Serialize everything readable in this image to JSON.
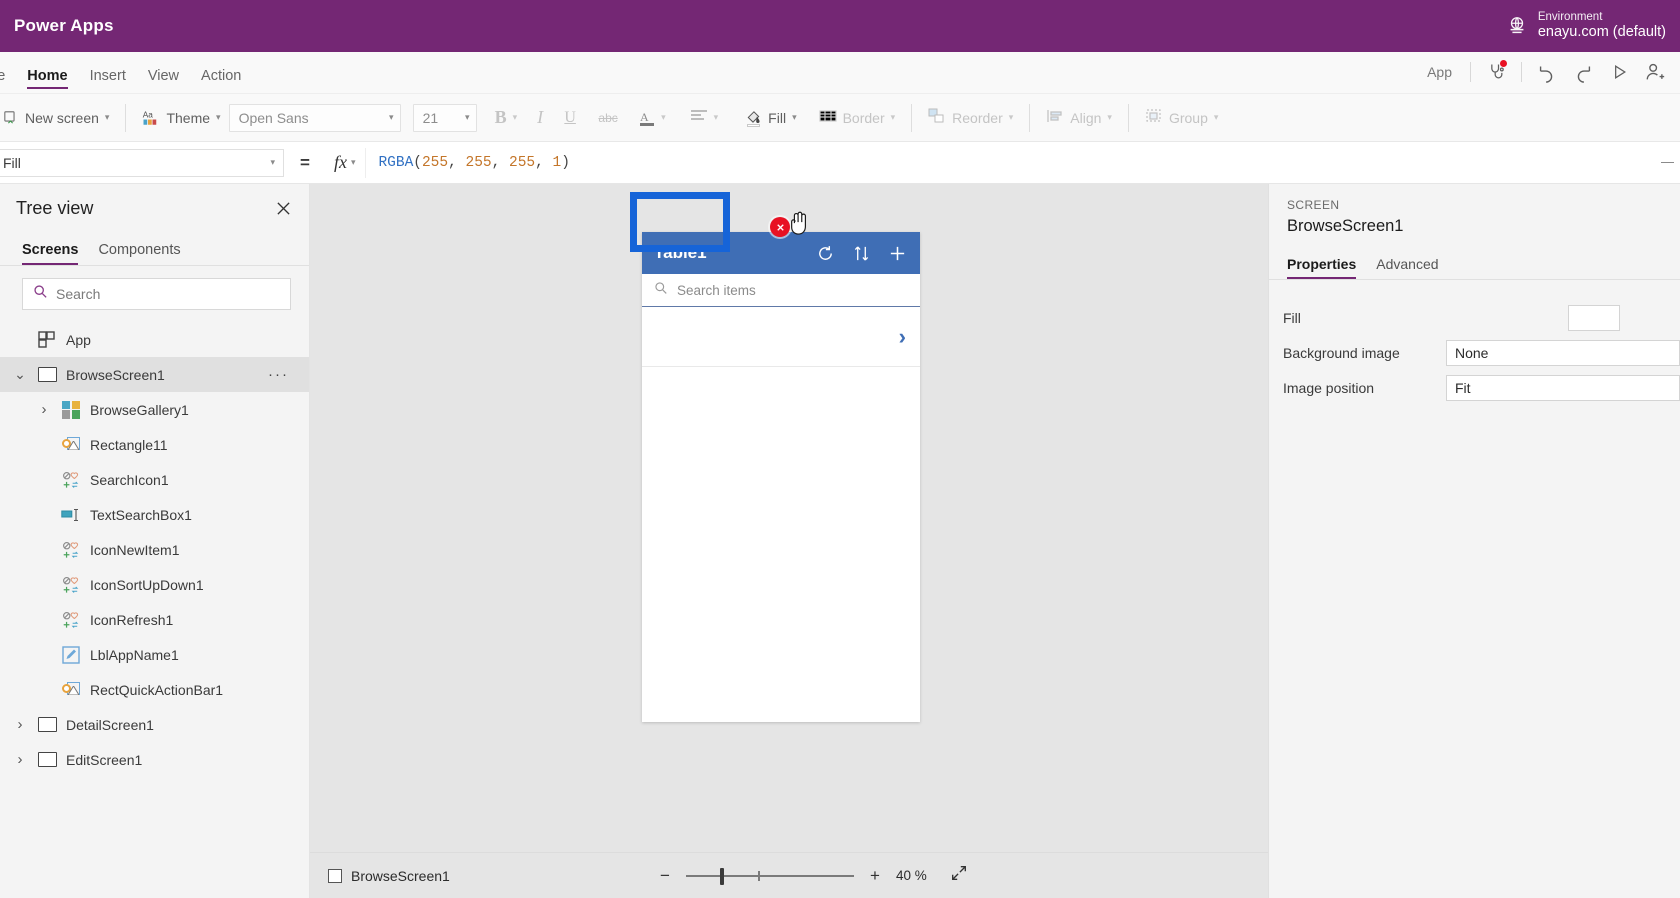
{
  "brand": {
    "title": "Power Apps",
    "globe_icon": "globe-icon",
    "environment_label": "Environment",
    "environment_value": "enayu.com (default)",
    "accent_color": "#742774"
  },
  "menubar": {
    "items": [
      {
        "label": "le",
        "active": false
      },
      {
        "label": "Home",
        "active": true
      },
      {
        "label": "Insert",
        "active": false
      },
      {
        "label": "View",
        "active": false
      },
      {
        "label": "Action",
        "active": false
      }
    ],
    "right": {
      "app_label": "App",
      "checker_icon": "stethoscope-icon",
      "checker_badge_color": "#e81123",
      "undo_icon": "undo-icon",
      "redo_icon": "redo-icon",
      "preview_icon": "play-icon",
      "share_icon": "share-user-icon"
    }
  },
  "ribbon": {
    "new_screen": "New screen",
    "theme": "Theme",
    "font_family": "Open Sans",
    "font_size": "21",
    "bold": "B",
    "italic": "I",
    "underline": "U",
    "strikethrough": "abc",
    "font_color_icon": "font-color-icon",
    "align_icon": "text-align-icon",
    "fill": "Fill",
    "border": "Border",
    "reorder": "Reorder",
    "align": "Align",
    "group": "Group"
  },
  "formula_bar": {
    "property": "Fill",
    "equals": "=",
    "fx": "fx",
    "formula_tokens": [
      {
        "t": "RGBA",
        "k": "fn"
      },
      {
        "t": "(",
        "k": "punct"
      },
      {
        "t": "255",
        "k": "num"
      },
      {
        "t": ", ",
        "k": "punct"
      },
      {
        "t": "255",
        "k": "num"
      },
      {
        "t": ", ",
        "k": "punct"
      },
      {
        "t": "255",
        "k": "num"
      },
      {
        "t": ", ",
        "k": "punct"
      },
      {
        "t": "1",
        "k": "num"
      },
      {
        "t": ")",
        "k": "punct"
      }
    ]
  },
  "treeview": {
    "title": "Tree view",
    "close_icon": "close-icon",
    "tabs": [
      {
        "label": "Screens",
        "active": true
      },
      {
        "label": "Components",
        "active": false
      }
    ],
    "search_placeholder": "Search",
    "search_value": "",
    "items": [
      {
        "label": "App",
        "icon": "app-icon",
        "indent": 0,
        "chevron": "",
        "selected": false,
        "dots": false
      },
      {
        "label": "BrowseScreen1",
        "icon": "screen-icon",
        "indent": 1,
        "chevron": "v",
        "selected": true,
        "dots": true
      },
      {
        "label": "BrowseGallery1",
        "icon": "gallery-icon",
        "indent": 2,
        "chevron": ">",
        "selected": false,
        "dots": false
      },
      {
        "label": "Rectangle11",
        "icon": "shape-icon",
        "indent": 2,
        "chevron": "",
        "selected": false,
        "dots": false
      },
      {
        "label": "SearchIcon1",
        "icon": "icon-control-icon",
        "indent": 2,
        "chevron": "",
        "selected": false,
        "dots": false
      },
      {
        "label": "TextSearchBox1",
        "icon": "textbox-icon",
        "indent": 2,
        "chevron": "",
        "selected": false,
        "dots": false
      },
      {
        "label": "IconNewItem1",
        "icon": "icon-control-icon",
        "indent": 2,
        "chevron": "",
        "selected": false,
        "dots": false
      },
      {
        "label": "IconSortUpDown1",
        "icon": "icon-control-icon",
        "indent": 2,
        "chevron": "",
        "selected": false,
        "dots": false
      },
      {
        "label": "IconRefresh1",
        "icon": "icon-control-icon",
        "indent": 2,
        "chevron": "",
        "selected": false,
        "dots": false
      },
      {
        "label": "LblAppName1",
        "icon": "label-icon",
        "indent": 2,
        "chevron": "",
        "selected": false,
        "dots": false
      },
      {
        "label": "RectQuickActionBar1",
        "icon": "shape-icon",
        "indent": 2,
        "chevron": "",
        "selected": false,
        "dots": false
      },
      {
        "label": "DetailScreen1",
        "icon": "screen-icon",
        "indent": 1,
        "chevron": ">",
        "selected": false,
        "dots": false
      },
      {
        "label": "EditScreen1",
        "icon": "screen-icon",
        "indent": 1,
        "chevron": ">",
        "selected": false,
        "dots": false
      }
    ]
  },
  "canvas": {
    "app_preview": {
      "header_title": "Table1",
      "header_color": "#3f6eb5",
      "refresh_icon": "refresh-icon",
      "sort_icon": "sort-updown-icon",
      "add_icon": "plus-icon",
      "search_placeholder": "Search items",
      "search_icon": "search-icon",
      "row_chevron_icon": "chevron-right-icon"
    },
    "selection": {
      "color": "#1664d8"
    },
    "error_badge": {
      "glyph": "x",
      "color": "#e81123",
      "name": "error-delete-badge"
    },
    "cursor": "hand-pointer-cursor"
  },
  "statusbar": {
    "screen_checkbox": false,
    "screen_label": "BrowseScreen1",
    "zoom_out": "−",
    "zoom_in": "+",
    "zoom_value": "40",
    "zoom_unit": "%",
    "fit_icon": "fit-screen-icon"
  },
  "properties": {
    "kind": "SCREEN",
    "name": "BrowseScreen1",
    "tabs": [
      {
        "label": "Properties",
        "active": true
      },
      {
        "label": "Advanced",
        "active": false
      }
    ],
    "rows": [
      {
        "label": "Fill",
        "type": "color",
        "value": "#ffffff"
      },
      {
        "label": "Background image",
        "type": "text",
        "value": "None"
      },
      {
        "label": "Image position",
        "type": "text",
        "value": "Fit"
      }
    ]
  }
}
